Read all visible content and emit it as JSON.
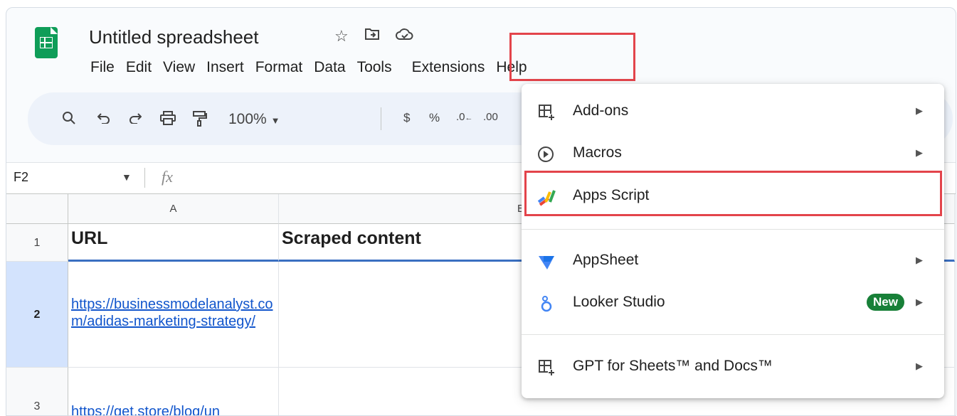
{
  "app": {
    "title": "Untitled spreadsheet",
    "icons": [
      "star-icon",
      "move-to-folder-icon",
      "cloud-saved-icon"
    ]
  },
  "menubar": {
    "items": [
      "File",
      "Edit",
      "View",
      "Insert",
      "Format",
      "Data",
      "Tools",
      "Extensions",
      "Help"
    ]
  },
  "toolbar": {
    "zoom": "100%",
    "currency": "$",
    "percent": "%",
    "dec_decrease": ".0",
    "dec_increase": ".00"
  },
  "formula_bar": {
    "cell_ref": "F2",
    "fx": "fx"
  },
  "grid": {
    "columns": [
      "A",
      "B"
    ],
    "rows": [
      {
        "num": "1",
        "a": "URL",
        "b": "Scraped content"
      },
      {
        "num": "2",
        "a": "https://businessmodelanalyst.com/adidas-marketing-strategy/",
        "b": ""
      },
      {
        "num": "3",
        "a": "https://get.store/blog/un",
        "b": ""
      }
    ]
  },
  "extensions_menu": {
    "items": [
      {
        "label": "Add-ons",
        "icon": "add-ons-icon",
        "submenu": true
      },
      {
        "label": "Macros",
        "icon": "macros-play-icon",
        "submenu": true
      },
      {
        "label": "Apps Script",
        "icon": "apps-script-icon",
        "submenu": false
      },
      {
        "label": "AppSheet",
        "icon": "appsheet-icon",
        "submenu": true
      },
      {
        "label": "Looker Studio",
        "icon": "looker-studio-icon",
        "submenu": true,
        "badge": "New"
      },
      {
        "label": "GPT for Sheets™ and Docs™",
        "icon": "gpt-addon-icon",
        "submenu": true
      }
    ]
  },
  "colors": {
    "highlight": "#e3444b",
    "link": "#1155cc",
    "badge": "#188038",
    "sheets_green": "#0f9d58"
  }
}
